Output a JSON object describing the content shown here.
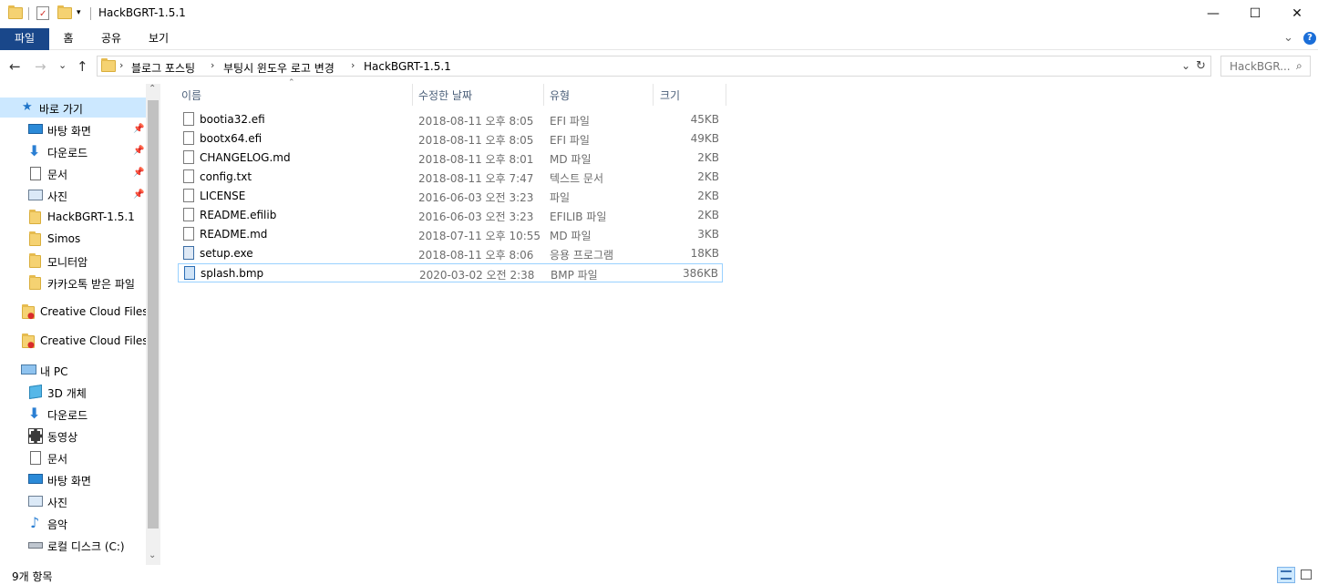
{
  "window": {
    "title": "HackBGRT-1.5.1",
    "minimize": "—",
    "maximize": "☐",
    "close": "✕"
  },
  "ribbon": {
    "tabs": [
      "파일",
      "홈",
      "공유",
      "보기"
    ],
    "expand": "⌄",
    "help": "?"
  },
  "nav": {
    "back": "←",
    "forward": "→",
    "recent": "⌄",
    "up": "↑"
  },
  "address": {
    "crumbs": [
      "블로그 포스팅",
      "부팅시 윈도우 로고 변경",
      "HackBGRT-1.5.1"
    ],
    "dropdown": "⌄",
    "refresh": "↻"
  },
  "search": {
    "placeholder": "HackBGR..."
  },
  "sidebar": {
    "quick_access": "바로 가기",
    "quick_items": [
      {
        "label": "바탕 화면",
        "icon": "desktop-icon",
        "pinned": true
      },
      {
        "label": "다운로드",
        "icon": "download-icon",
        "pinned": true
      },
      {
        "label": "문서",
        "icon": "document-icon",
        "pinned": true
      },
      {
        "label": "사진",
        "icon": "picture-icon",
        "pinned": true
      },
      {
        "label": "HackBGRT-1.5.1",
        "icon": "folder-icon",
        "pinned": false
      },
      {
        "label": "Simos",
        "icon": "folder-icon",
        "pinned": false
      },
      {
        "label": "모니터암",
        "icon": "folder-icon",
        "pinned": false
      },
      {
        "label": "카카오톡 받은 파일",
        "icon": "folder-icon",
        "pinned": false
      }
    ],
    "creative_cloud_1": "Creative Cloud Files",
    "creative_cloud_2": "Creative Cloud Files",
    "this_pc": "내 PC",
    "pc_items": [
      {
        "label": "3D 개체",
        "icon": "3d-objects-icon"
      },
      {
        "label": "다운로드",
        "icon": "download-icon"
      },
      {
        "label": "동영상",
        "icon": "video-icon"
      },
      {
        "label": "문서",
        "icon": "document-icon"
      },
      {
        "label": "바탕 화면",
        "icon": "desktop-icon"
      },
      {
        "label": "사진",
        "icon": "picture-icon"
      },
      {
        "label": "음악",
        "icon": "music-icon"
      },
      {
        "label": "로컬 디스크 (C:)",
        "icon": "drive-icon"
      }
    ]
  },
  "columns": {
    "name": "이름",
    "date": "수정한 날짜",
    "type": "유형",
    "size": "크기"
  },
  "files": [
    {
      "name": "bootia32.efi",
      "date": "2018-08-11 오후 8:05",
      "type": "EFI 파일",
      "size": "45KB",
      "icon": "file-icon"
    },
    {
      "name": "bootx64.efi",
      "date": "2018-08-11 오후 8:05",
      "type": "EFI 파일",
      "size": "49KB",
      "icon": "file-icon"
    },
    {
      "name": "CHANGELOG.md",
      "date": "2018-08-11 오후 8:01",
      "type": "MD 파일",
      "size": "2KB",
      "icon": "file-icon"
    },
    {
      "name": "config.txt",
      "date": "2018-08-11 오후 7:47",
      "type": "텍스트 문서",
      "size": "2KB",
      "icon": "text-file-icon"
    },
    {
      "name": "LICENSE",
      "date": "2016-06-03 오전 3:23",
      "type": "파일",
      "size": "2KB",
      "icon": "file-icon"
    },
    {
      "name": "README.efilib",
      "date": "2016-06-03 오전 3:23",
      "type": "EFILIB 파일",
      "size": "2KB",
      "icon": "file-icon"
    },
    {
      "name": "README.md",
      "date": "2018-07-11 오후 10:55",
      "type": "MD 파일",
      "size": "3KB",
      "icon": "file-icon"
    },
    {
      "name": "setup.exe",
      "date": "2018-08-11 오후 8:06",
      "type": "응용 프로그램",
      "size": "18KB",
      "icon": "exe-icon"
    },
    {
      "name": "splash.bmp",
      "date": "2020-03-02 오전 2:38",
      "type": "BMP 파일",
      "size": "386KB",
      "icon": "bmp-icon"
    }
  ],
  "status": {
    "text": "9개 항목"
  },
  "colors": {
    "accent": "#19478a",
    "selection_border": "#99d1ff"
  }
}
